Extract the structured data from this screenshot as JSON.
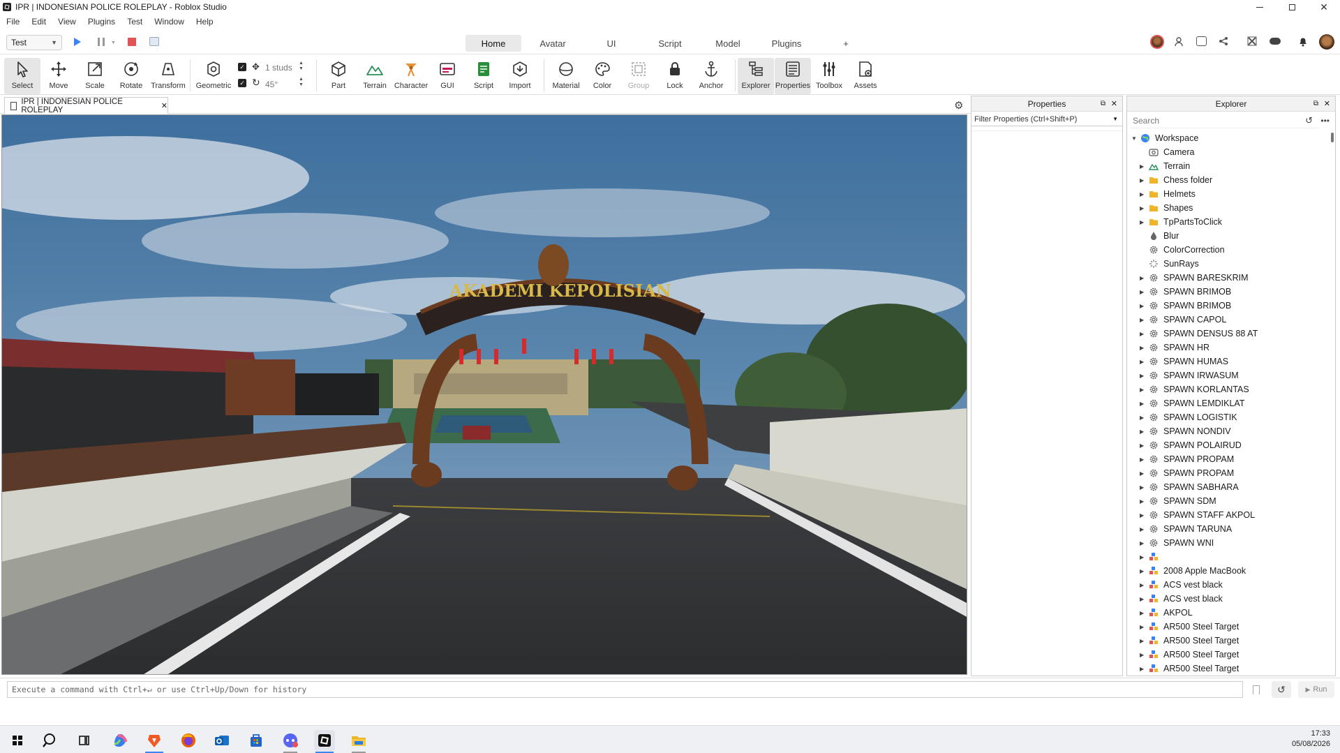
{
  "window": {
    "title": "IPR | INDONESIAN POLICE ROLEPLAY - Roblox Studio"
  },
  "menu": [
    "File",
    "Edit",
    "View",
    "Plugins",
    "Test",
    "Window",
    "Help"
  ],
  "test_select": {
    "value": "Test"
  },
  "tabs": [
    {
      "label": "Home",
      "active": true
    },
    {
      "label": "Avatar"
    },
    {
      "label": "UI"
    },
    {
      "label": "Script"
    },
    {
      "label": "Model"
    },
    {
      "label": "Plugins"
    },
    {
      "label": "+"
    }
  ],
  "ribbon": {
    "select": "Select",
    "move": "Move",
    "scale": "Scale",
    "rotate": "Rotate",
    "transform": "Transform",
    "geometric": "Geometric",
    "move_step": "1 studs",
    "rotate_step": "45°",
    "part": "Part",
    "terrain": "Terrain",
    "character": "Character",
    "gui": "GUI",
    "script": "Script",
    "import": "Import",
    "material": "Material",
    "color": "Color",
    "group": "Group",
    "lock": "Lock",
    "anchor": "Anchor",
    "explorer": "Explorer",
    "properties": "Properties",
    "toolbox": "Toolbox",
    "assets": "Assets"
  },
  "doc_tab": {
    "label": "IPR | INDONESIAN POLICE ROLEPLAY"
  },
  "viewport": {
    "gate_sign": "AKADEMI KEPOLISIAN"
  },
  "properties": {
    "title": "Properties",
    "filter_placeholder": "Filter Properties (Ctrl+Shift+P)"
  },
  "explorer": {
    "title": "Explorer",
    "search_placeholder": "Search",
    "items": [
      {
        "label": "Workspace",
        "icon": "globe",
        "level": 0,
        "expanded": true
      },
      {
        "label": "Camera",
        "icon": "camera",
        "level": 1
      },
      {
        "label": "Terrain",
        "icon": "terrain",
        "level": 1,
        "arrow": true
      },
      {
        "label": "Chess folder",
        "icon": "folder",
        "level": 1,
        "arrow": true
      },
      {
        "label": "Helmets",
        "icon": "folder",
        "level": 1,
        "arrow": true
      },
      {
        "label": "Shapes",
        "icon": "folder",
        "level": 1,
        "arrow": true
      },
      {
        "label": "TpPartsToClick",
        "icon": "folder",
        "level": 1,
        "arrow": true
      },
      {
        "label": "Blur",
        "icon": "drop",
        "level": 1
      },
      {
        "label": "ColorCorrection",
        "icon": "gear",
        "level": 1
      },
      {
        "label": "SunRays",
        "icon": "sun",
        "level": 1
      },
      {
        "label": "SPAWN BARESKRIM",
        "icon": "gear",
        "level": 1,
        "arrow": true
      },
      {
        "label": "SPAWN BRIMOB",
        "icon": "gear",
        "level": 1,
        "arrow": true
      },
      {
        "label": "SPAWN BRIMOB",
        "icon": "gear",
        "level": 1,
        "arrow": true
      },
      {
        "label": "SPAWN CAPOL",
        "icon": "gear",
        "level": 1,
        "arrow": true
      },
      {
        "label": "SPAWN DENSUS 88 AT",
        "icon": "gear",
        "level": 1,
        "arrow": true
      },
      {
        "label": "SPAWN HR",
        "icon": "gear",
        "level": 1,
        "arrow": true
      },
      {
        "label": "SPAWN HUMAS",
        "icon": "gear",
        "level": 1,
        "arrow": true
      },
      {
        "label": "SPAWN IRWASUM",
        "icon": "gear",
        "level": 1,
        "arrow": true
      },
      {
        "label": "SPAWN KORLANTAS",
        "icon": "gear",
        "level": 1,
        "arrow": true
      },
      {
        "label": "SPAWN LEMDIKLAT",
        "icon": "gear",
        "level": 1,
        "arrow": true
      },
      {
        "label": "SPAWN LOGISTIK",
        "icon": "gear",
        "level": 1,
        "arrow": true
      },
      {
        "label": "SPAWN NONDIV",
        "icon": "gear",
        "level": 1,
        "arrow": true
      },
      {
        "label": "SPAWN POLAIRUD",
        "icon": "gear",
        "level": 1,
        "arrow": true
      },
      {
        "label": "SPAWN PROPAM",
        "icon": "gear",
        "level": 1,
        "arrow": true
      },
      {
        "label": "SPAWN PROPAM",
        "icon": "gear",
        "level": 1,
        "arrow": true
      },
      {
        "label": "SPAWN SABHARA",
        "icon": "gear",
        "level": 1,
        "arrow": true
      },
      {
        "label": "SPAWN SDM",
        "icon": "gear",
        "level": 1,
        "arrow": true
      },
      {
        "label": "SPAWN STAFF AKPOL",
        "icon": "gear",
        "level": 1,
        "arrow": true
      },
      {
        "label": "SPAWN TARUNA",
        "icon": "gear",
        "level": 1,
        "arrow": true
      },
      {
        "label": "SPAWN WNI",
        "icon": "gear",
        "level": 1,
        "arrow": true
      },
      {
        "label": "",
        "icon": "model",
        "level": 1,
        "arrow": true
      },
      {
        "label": "2008 Apple MacBook",
        "icon": "model",
        "level": 1,
        "arrow": true
      },
      {
        "label": "ACS vest black",
        "icon": "model",
        "level": 1,
        "arrow": true
      },
      {
        "label": "ACS vest black",
        "icon": "model",
        "level": 1,
        "arrow": true
      },
      {
        "label": "AKPOL",
        "icon": "model",
        "level": 1,
        "arrow": true
      },
      {
        "label": "AR500 Steel Target",
        "icon": "model",
        "level": 1,
        "arrow": true
      },
      {
        "label": "AR500 Steel Target",
        "icon": "model",
        "level": 1,
        "arrow": true
      },
      {
        "label": "AR500 Steel Target",
        "icon": "model",
        "level": 1,
        "arrow": true
      },
      {
        "label": "AR500 Steel Target",
        "icon": "model",
        "level": 1,
        "arrow": true
      }
    ]
  },
  "command_bar": {
    "placeholder": "Execute a command with Ctrl+↵ or use Ctrl+Up/Down for history",
    "run": "Run"
  },
  "taskbar": {
    "time": "17:33",
    "date": "05/08/2026"
  },
  "colors": {
    "accent": "#3b82f6",
    "stop": "#e25454",
    "folder": "#f0b429"
  }
}
